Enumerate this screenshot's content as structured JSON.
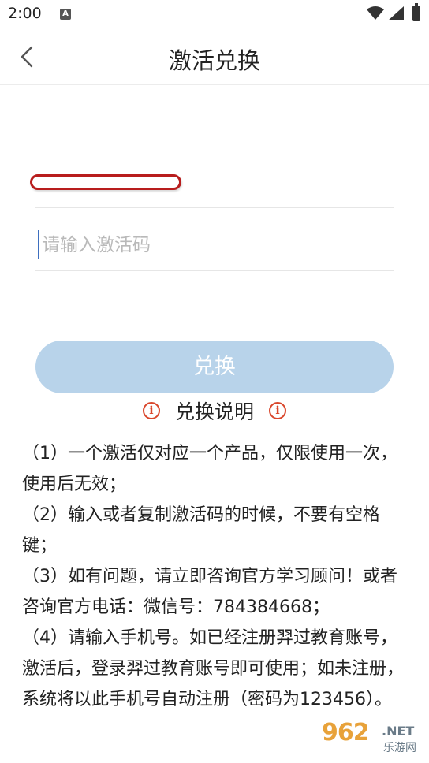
{
  "status_bar": {
    "time": "2:00",
    "notification_letter": "A",
    "icons": [
      "a-notification-icon",
      "wifi-icon",
      "signal-icon",
      "battery-icon"
    ]
  },
  "header": {
    "title": "激活兑换",
    "back_icon": "chevron-left-icon"
  },
  "form": {
    "phone_value": "",
    "code_placeholder": "请输入激活码",
    "code_value": "",
    "submit_label": "兑换",
    "submit_color": "#b8d3ea"
  },
  "instructions": {
    "title": "兑换说明",
    "icon": "info-icon",
    "icon_glyph": "i",
    "icon_color": "#d9462b",
    "items": [
      "（1）一个激活仅对应一个产品，仅限使用一次，使用后无效；",
      "（2）输入或者复制激活码的时候，不要有空格键；",
      "（3）如有问题，请立即咨询官方学习顾问！或者咨询官方电话：微信号：784384668；",
      "（4）请输入手机号。如已经注册羿过教育账号，激活后，登录羿过教育账号即可使用；如未注册，系统将以此手机号自动注册（密码为123456）。"
    ]
  },
  "watermark": {
    "number": "962",
    "suffix": ".NET",
    "sub": "乐游网"
  }
}
